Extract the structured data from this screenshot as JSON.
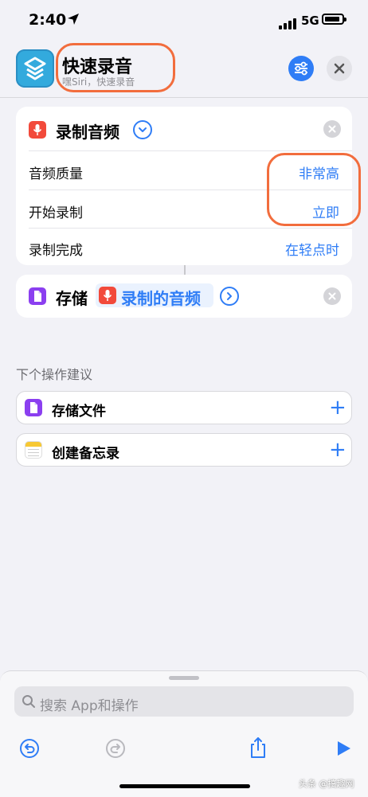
{
  "status_bar": {
    "time": "2:40",
    "carrier": "5G"
  },
  "header": {
    "title": "快速录音",
    "subtitle": "嘿Siri，快速录音",
    "accent_color": "#2f7df6",
    "icons": [
      "shortcuts-app-icon",
      "settings-sliders-icon",
      "close-icon"
    ]
  },
  "record_action": {
    "title": "录制音频",
    "rows": [
      {
        "label": "音频质量",
        "value": "非常高"
      },
      {
        "label": "开始录制",
        "value": "立即"
      },
      {
        "label": "录制完成",
        "value": "在轻点时"
      }
    ]
  },
  "save_action": {
    "verb": "存储",
    "variable": "录制的音频"
  },
  "suggestions": {
    "header": "下个操作建议",
    "items": [
      {
        "label": "存储文件",
        "icon": "file-icon"
      },
      {
        "label": "创建备忘录",
        "icon": "notes-icon"
      }
    ]
  },
  "bottom": {
    "search_placeholder": "搜索 App和操作"
  },
  "watermark": "头条 @搞趣网",
  "annotation_color": "#f26d3d"
}
